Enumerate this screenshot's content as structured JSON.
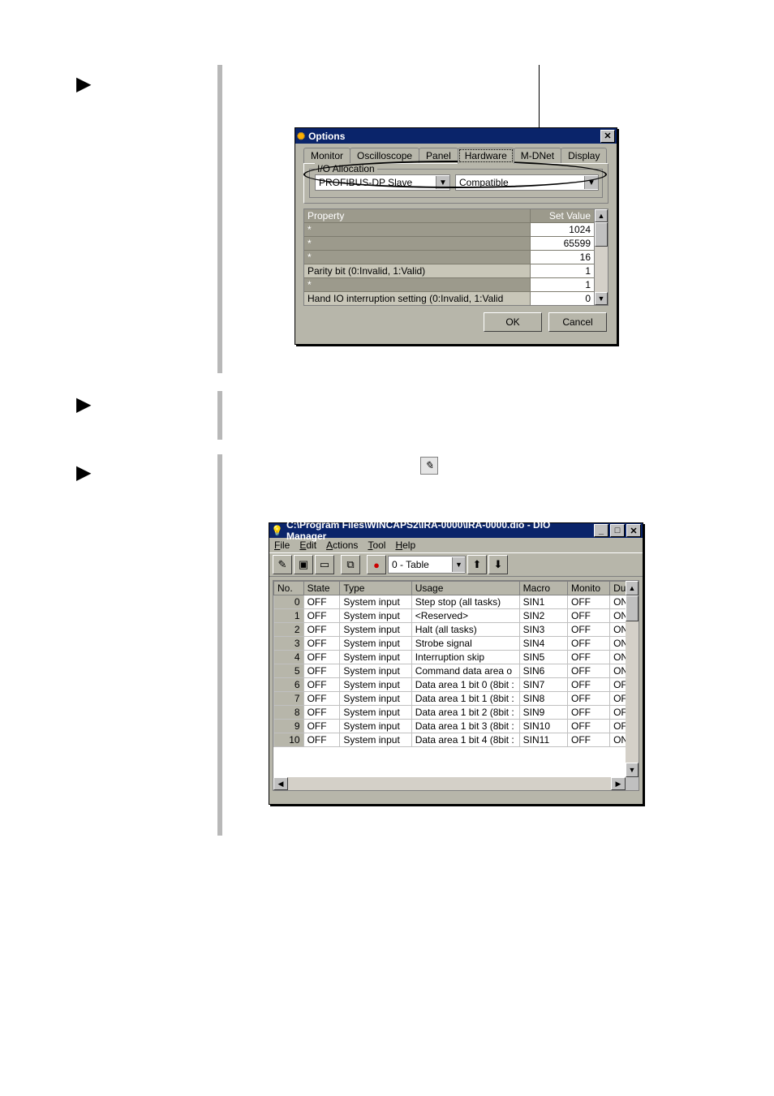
{
  "optionsDialog": {
    "title": "Options",
    "tabs": [
      "Monitor",
      "Oscilloscope",
      "Panel",
      "Hardware",
      "M-DNet",
      "Display"
    ],
    "activeTab": "Hardware",
    "groupLabel": "I/O Allocation",
    "combo1": "PROFIBUS-DP Slave",
    "combo2": "Compatible",
    "headers": {
      "prop": "Property",
      "val": "Set Value"
    },
    "rows": [
      {
        "p": "*",
        "v": "1024"
      },
      {
        "p": "*",
        "v": "65599"
      },
      {
        "p": "*",
        "v": "16"
      },
      {
        "p": "Parity bit (0:Invalid, 1:Valid)",
        "v": "1",
        "light": true
      },
      {
        "p": "*",
        "v": "1"
      },
      {
        "p": "Hand IO  interruption setting (0:Invalid, 1:Valid",
        "v": "0",
        "light": true
      }
    ],
    "ok": "OK",
    "cancel": "Cancel"
  },
  "dioManager": {
    "title": "C:\\Program Files\\WINCAPS2\\IRA-0000\\IRA-0000.dio - DIO Manager",
    "menus": [
      "File",
      "Edit",
      "Actions",
      "Tool",
      "Help"
    ],
    "combo": "0 - Table",
    "cols": [
      "No.",
      "State",
      "Type",
      "Usage",
      "Macro",
      "Monito",
      "Du"
    ],
    "rows": [
      {
        "n": "0",
        "s": "OFF",
        "t": "System input",
        "u": "Step stop (all tasks)",
        "m": "SIN1",
        "mo": "OFF",
        "d": "ON"
      },
      {
        "n": "1",
        "s": "OFF",
        "t": "System input",
        "u": "<Reserved>",
        "m": "SIN2",
        "mo": "OFF",
        "d": "ON"
      },
      {
        "n": "2",
        "s": "OFF",
        "t": "System input",
        "u": "Halt (all tasks)",
        "m": "SIN3",
        "mo": "OFF",
        "d": "ON"
      },
      {
        "n": "3",
        "s": "OFF",
        "t": "System input",
        "u": "Strobe signal",
        "m": "SIN4",
        "mo": "OFF",
        "d": "ON"
      },
      {
        "n": "4",
        "s": "OFF",
        "t": "System input",
        "u": "Interruption skip",
        "m": "SIN5",
        "mo": "OFF",
        "d": "ON"
      },
      {
        "n": "5",
        "s": "OFF",
        "t": "System input",
        "u": "Command data area o",
        "m": "SIN6",
        "mo": "OFF",
        "d": "ON"
      },
      {
        "n": "6",
        "s": "OFF",
        "t": "System input",
        "u": "Data area 1 bit 0 (8bit :",
        "m": "SIN7",
        "mo": "OFF",
        "d": "OF"
      },
      {
        "n": "7",
        "s": "OFF",
        "t": "System input",
        "u": "Data area 1 bit 1 (8bit :",
        "m": "SIN8",
        "mo": "OFF",
        "d": "OF"
      },
      {
        "n": "8",
        "s": "OFF",
        "t": "System input",
        "u": "Data area 1 bit 2 (8bit :",
        "m": "SIN9",
        "mo": "OFF",
        "d": "OF"
      },
      {
        "n": "9",
        "s": "OFF",
        "t": "System input",
        "u": "Data area 1 bit 3 (8bit :",
        "m": "SIN10",
        "mo": "OFF",
        "d": "OF"
      },
      {
        "n": "10",
        "s": "OFF",
        "t": "System input",
        "u": "Data area 1 bit 4 (8bit :",
        "m": "SIN11",
        "mo": "OFF",
        "d": "ON"
      }
    ]
  }
}
